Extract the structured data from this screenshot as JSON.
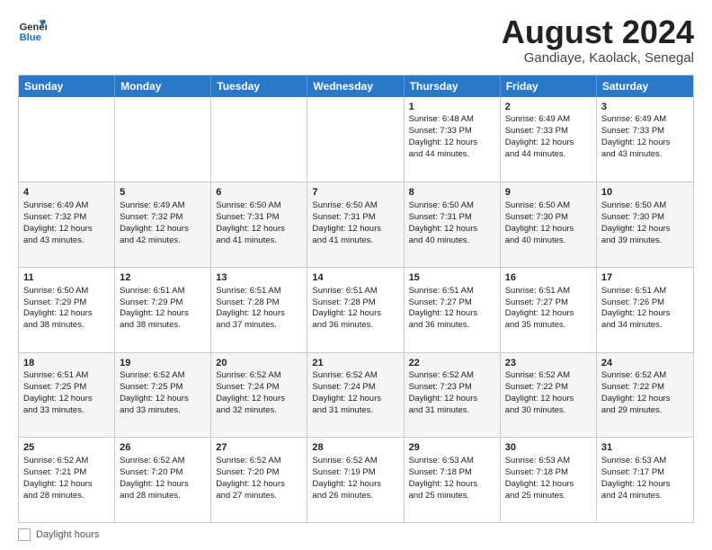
{
  "header": {
    "logo_line1": "General",
    "logo_line2": "Blue",
    "title": "August 2024",
    "subtitle": "Gandiaye, Kaolack, Senegal"
  },
  "days_of_week": [
    "Sunday",
    "Monday",
    "Tuesday",
    "Wednesday",
    "Thursday",
    "Friday",
    "Saturday"
  ],
  "weeks": [
    [
      {
        "day": "",
        "info": ""
      },
      {
        "day": "",
        "info": ""
      },
      {
        "day": "",
        "info": ""
      },
      {
        "day": "",
        "info": ""
      },
      {
        "day": "1",
        "info": "Sunrise: 6:48 AM\nSunset: 7:33 PM\nDaylight: 12 hours\nand 44 minutes."
      },
      {
        "day": "2",
        "info": "Sunrise: 6:49 AM\nSunset: 7:33 PM\nDaylight: 12 hours\nand 44 minutes."
      },
      {
        "day": "3",
        "info": "Sunrise: 6:49 AM\nSunset: 7:33 PM\nDaylight: 12 hours\nand 43 minutes."
      }
    ],
    [
      {
        "day": "4",
        "info": "Sunrise: 6:49 AM\nSunset: 7:32 PM\nDaylight: 12 hours\nand 43 minutes."
      },
      {
        "day": "5",
        "info": "Sunrise: 6:49 AM\nSunset: 7:32 PM\nDaylight: 12 hours\nand 42 minutes."
      },
      {
        "day": "6",
        "info": "Sunrise: 6:50 AM\nSunset: 7:31 PM\nDaylight: 12 hours\nand 41 minutes."
      },
      {
        "day": "7",
        "info": "Sunrise: 6:50 AM\nSunset: 7:31 PM\nDaylight: 12 hours\nand 41 minutes."
      },
      {
        "day": "8",
        "info": "Sunrise: 6:50 AM\nSunset: 7:31 PM\nDaylight: 12 hours\nand 40 minutes."
      },
      {
        "day": "9",
        "info": "Sunrise: 6:50 AM\nSunset: 7:30 PM\nDaylight: 12 hours\nand 40 minutes."
      },
      {
        "day": "10",
        "info": "Sunrise: 6:50 AM\nSunset: 7:30 PM\nDaylight: 12 hours\nand 39 minutes."
      }
    ],
    [
      {
        "day": "11",
        "info": "Sunrise: 6:50 AM\nSunset: 7:29 PM\nDaylight: 12 hours\nand 38 minutes."
      },
      {
        "day": "12",
        "info": "Sunrise: 6:51 AM\nSunset: 7:29 PM\nDaylight: 12 hours\nand 38 minutes."
      },
      {
        "day": "13",
        "info": "Sunrise: 6:51 AM\nSunset: 7:28 PM\nDaylight: 12 hours\nand 37 minutes."
      },
      {
        "day": "14",
        "info": "Sunrise: 6:51 AM\nSunset: 7:28 PM\nDaylight: 12 hours\nand 36 minutes."
      },
      {
        "day": "15",
        "info": "Sunrise: 6:51 AM\nSunset: 7:27 PM\nDaylight: 12 hours\nand 36 minutes."
      },
      {
        "day": "16",
        "info": "Sunrise: 6:51 AM\nSunset: 7:27 PM\nDaylight: 12 hours\nand 35 minutes."
      },
      {
        "day": "17",
        "info": "Sunrise: 6:51 AM\nSunset: 7:26 PM\nDaylight: 12 hours\nand 34 minutes."
      }
    ],
    [
      {
        "day": "18",
        "info": "Sunrise: 6:51 AM\nSunset: 7:25 PM\nDaylight: 12 hours\nand 33 minutes."
      },
      {
        "day": "19",
        "info": "Sunrise: 6:52 AM\nSunset: 7:25 PM\nDaylight: 12 hours\nand 33 minutes."
      },
      {
        "day": "20",
        "info": "Sunrise: 6:52 AM\nSunset: 7:24 PM\nDaylight: 12 hours\nand 32 minutes."
      },
      {
        "day": "21",
        "info": "Sunrise: 6:52 AM\nSunset: 7:24 PM\nDaylight: 12 hours\nand 31 minutes."
      },
      {
        "day": "22",
        "info": "Sunrise: 6:52 AM\nSunset: 7:23 PM\nDaylight: 12 hours\nand 31 minutes."
      },
      {
        "day": "23",
        "info": "Sunrise: 6:52 AM\nSunset: 7:22 PM\nDaylight: 12 hours\nand 30 minutes."
      },
      {
        "day": "24",
        "info": "Sunrise: 6:52 AM\nSunset: 7:22 PM\nDaylight: 12 hours\nand 29 minutes."
      }
    ],
    [
      {
        "day": "25",
        "info": "Sunrise: 6:52 AM\nSunset: 7:21 PM\nDaylight: 12 hours\nand 28 minutes."
      },
      {
        "day": "26",
        "info": "Sunrise: 6:52 AM\nSunset: 7:20 PM\nDaylight: 12 hours\nand 28 minutes."
      },
      {
        "day": "27",
        "info": "Sunrise: 6:52 AM\nSunset: 7:20 PM\nDaylight: 12 hours\nand 27 minutes."
      },
      {
        "day": "28",
        "info": "Sunrise: 6:52 AM\nSunset: 7:19 PM\nDaylight: 12 hours\nand 26 minutes."
      },
      {
        "day": "29",
        "info": "Sunrise: 6:53 AM\nSunset: 7:18 PM\nDaylight: 12 hours\nand 25 minutes."
      },
      {
        "day": "30",
        "info": "Sunrise: 6:53 AM\nSunset: 7:18 PM\nDaylight: 12 hours\nand 25 minutes."
      },
      {
        "day": "31",
        "info": "Sunrise: 6:53 AM\nSunset: 7:17 PM\nDaylight: 12 hours\nand 24 minutes."
      }
    ]
  ],
  "footer": {
    "daylight_label": "Daylight hours"
  }
}
